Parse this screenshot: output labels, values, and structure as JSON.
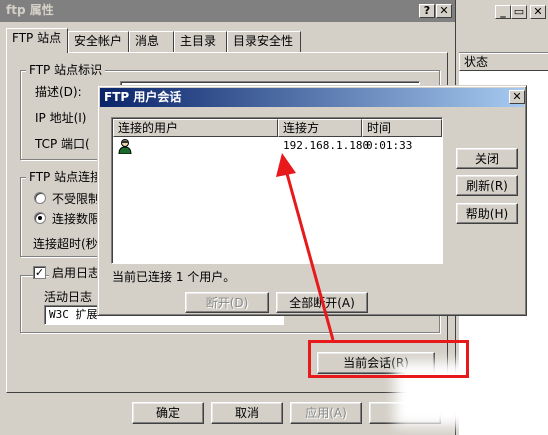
{
  "bg_window": {
    "min_label": "_",
    "restore_label": "▭",
    "close_label": "✕",
    "column_header": "状态"
  },
  "properties": {
    "title": "ftp 属性",
    "help_btn": "?",
    "close_btn": "✕",
    "tabs": [
      "FTP 站点",
      "安全帐户",
      "消息",
      "主目录",
      "目录安全性"
    ],
    "group_identity": "FTP 站点标识",
    "desc_label": "描述(D):",
    "ip_label": "IP 地址(I)",
    "tcp_label": "TCP 端口(",
    "group_connections": "FTP 站点连接",
    "radio_unlimited": "不受限制",
    "radio_limited": "连接数限",
    "timeout_label": "连接超时(秒",
    "logging_label": "启用日志",
    "active_log_label": "活动日志",
    "log_format_value": "W3C 扩展",
    "current_sessions_btn": "当前会话(R)",
    "ok_btn": "确定",
    "cancel_btn": "取消",
    "apply_btn": "应用(A)"
  },
  "sessions_dialog": {
    "title": "FTP 用户会话",
    "close_btn": "✕",
    "columns": [
      "连接的用户",
      "连接方",
      "时间"
    ],
    "rows": [
      {
        "user": "",
        "from": "192.168.1.180",
        "time": "0:01:33"
      }
    ],
    "status_text": "当前已连接 1 个用户。",
    "disconnect_btn": "断开(D)",
    "disconnect_all_btn": "全部断开(A)",
    "close_action_btn": "关闭",
    "refresh_btn": "刷新(R)",
    "help_btn": "帮助(H)"
  },
  "colors": {
    "title_active_start": "#0a246a",
    "title_active_end": "#a6caf0",
    "title_inactive": "#808080",
    "face": "#d4d0c8",
    "annotation_red": "#e8191a"
  }
}
